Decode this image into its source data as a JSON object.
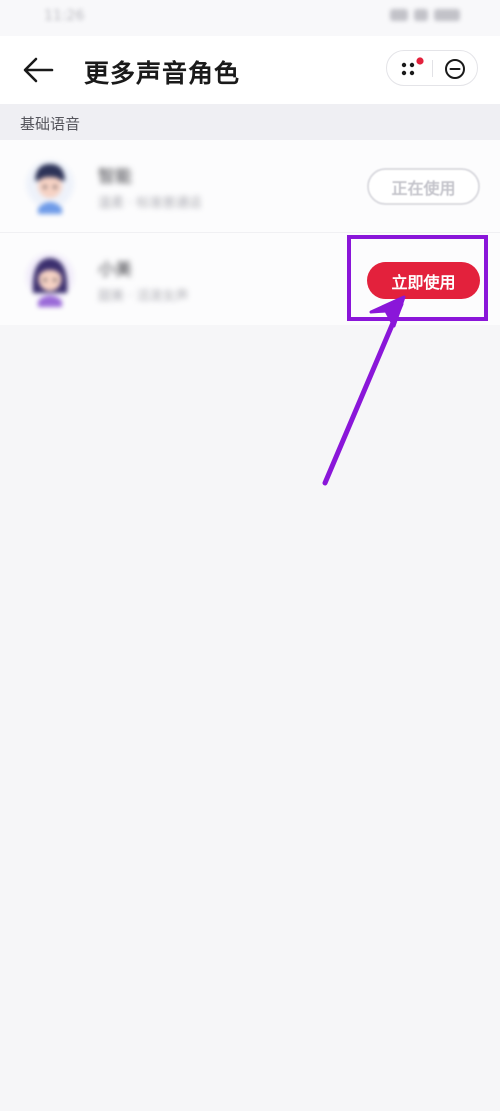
{
  "status_bar": {
    "time": "11:26"
  },
  "header": {
    "back_icon": "arrow-left-icon",
    "title": "更多声音角色",
    "more_icon": "more-dots-icon",
    "close_icon": "close-circle-icon"
  },
  "section": {
    "title": "基础语音"
  },
  "voices": [
    {
      "name": "智能",
      "description": "温柔 · 标准普通话",
      "button_label": "正在使用",
      "state": "in-use"
    },
    {
      "name": "小美",
      "description": "甜美 · 活泼女声",
      "button_label": "立即使用",
      "state": "available"
    }
  ],
  "colors": {
    "accent_red": "#e3213c",
    "annotation_purple": "#8a16d9",
    "badge_dot": "#e3213c"
  }
}
